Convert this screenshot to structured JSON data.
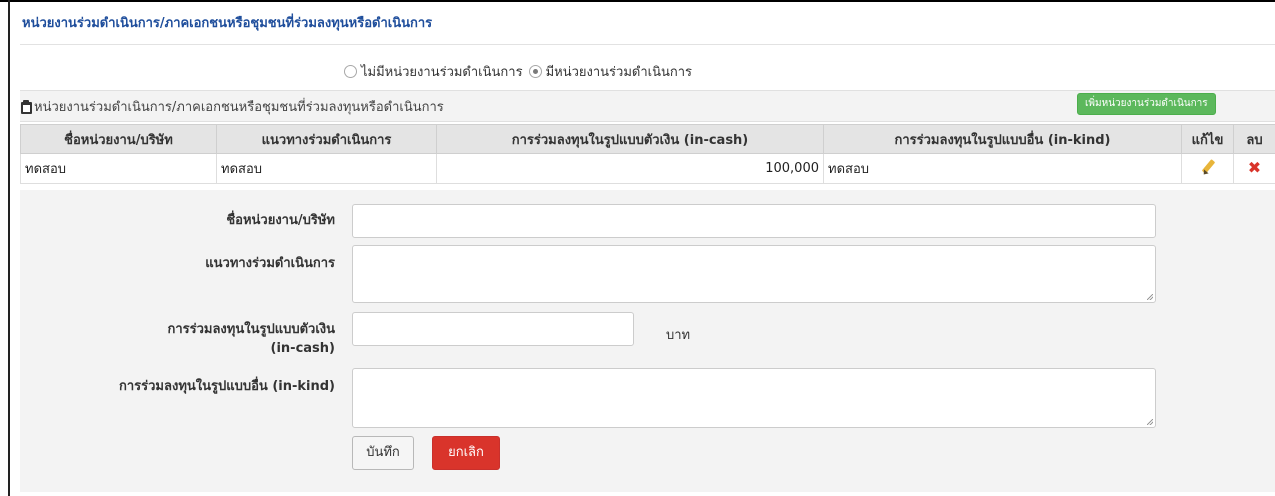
{
  "section": {
    "title": "หน่วยงานร่วมดำเนินการ/ภาคเอกชนหรือชุมชนที่ร่วมลงทุนหรือดำเนินการ"
  },
  "options": {
    "no_partner_label": "ไม่มีหน่วยงานร่วมดำเนินการ",
    "has_partner_label": "มีหน่วยงานร่วมดำเนินการ",
    "selected": "has_partner"
  },
  "panel": {
    "title": "หน่วยงานร่วมดำเนินการ/ภาคเอกชนหรือชุมชนที่ร่วมลงทุนหรือดำเนินการ",
    "add_button": "เพิ่มหน่วยงานร่วมดำเนินการ"
  },
  "table": {
    "headers": [
      "ชื่อหน่วยงาน/บริษัท",
      "แนวทางร่วมดำเนินการ",
      "การร่วมลงทุนในรูปแบบตัวเงิน (in-cash)",
      "การร่วมลงทุนในรูปแบบอื่น (in-kind)",
      "แก้ไข",
      "ลบ"
    ],
    "rows": [
      {
        "name": "ทดสอบ",
        "approach": "ทดสอบ",
        "in_cash": "100,000",
        "in_kind": "ทดสอบ",
        "edit_icon": "pencil-icon",
        "delete_icon": "delete-icon"
      }
    ]
  },
  "form": {
    "name_label": "ชื่อหน่วยงาน/บริษัท",
    "name_value": "",
    "approach_label": "แนวทางร่วมดำเนินการ",
    "approach_value": "",
    "in_cash_label_line1": "การร่วมลงทุนในรูปแบบตัวเงิน",
    "in_cash_label_line2": "(in-cash)",
    "in_cash_value": "",
    "in_cash_unit": "บาท",
    "in_kind_label": "การร่วมลงทุนในรูปแบบอื่น (in-kind)",
    "in_kind_value": "",
    "save_button": "บันทึก",
    "cancel_button": "ยกเลิก"
  },
  "colors": {
    "title_blue": "#1f4e9c",
    "add_green": "#5cb85c",
    "cancel_red": "#d9342b",
    "pencil_yellow": "#e8b53a"
  }
}
